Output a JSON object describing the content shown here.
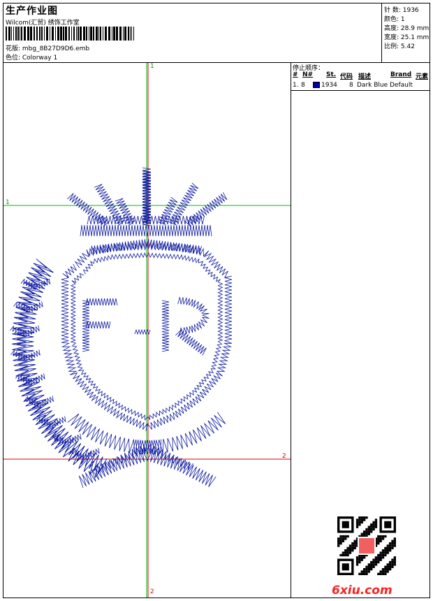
{
  "header": {
    "title": "生产作业图",
    "studio": "Wilcom(汇贸) 绣饰工作室",
    "pattern_label": "花版: mbg_8B27D9D6.emb",
    "colorway_label": "色位:  Colorway 1"
  },
  "stats": {
    "stitches": "针 数: 1936",
    "colors": "颜色: 1",
    "height": "高度: 28.9 mm",
    "width": "宽度: 25.1 mm",
    "scale": "比例: 5.42"
  },
  "stop_sequence": {
    "title": "停止顺序：",
    "columns": [
      "#",
      "N#",
      "St.",
      "代码",
      "描述",
      "Brand",
      "元素"
    ],
    "rows": [
      {
        "idx": "1.",
        "needle": "8",
        "stitches": "1934",
        "code": "8",
        "description": "Dark Blue",
        "brand": "Default",
        "color": "#0000a0"
      }
    ]
  },
  "guides": {
    "top_marker": "1",
    "left_marker": "1",
    "right_marker": "2",
    "bottom_marker": "2"
  },
  "design": {
    "letters": "F-R",
    "thread_color": "#0d1aa0"
  },
  "watermark": {
    "logo_text": "6xiu.com"
  }
}
